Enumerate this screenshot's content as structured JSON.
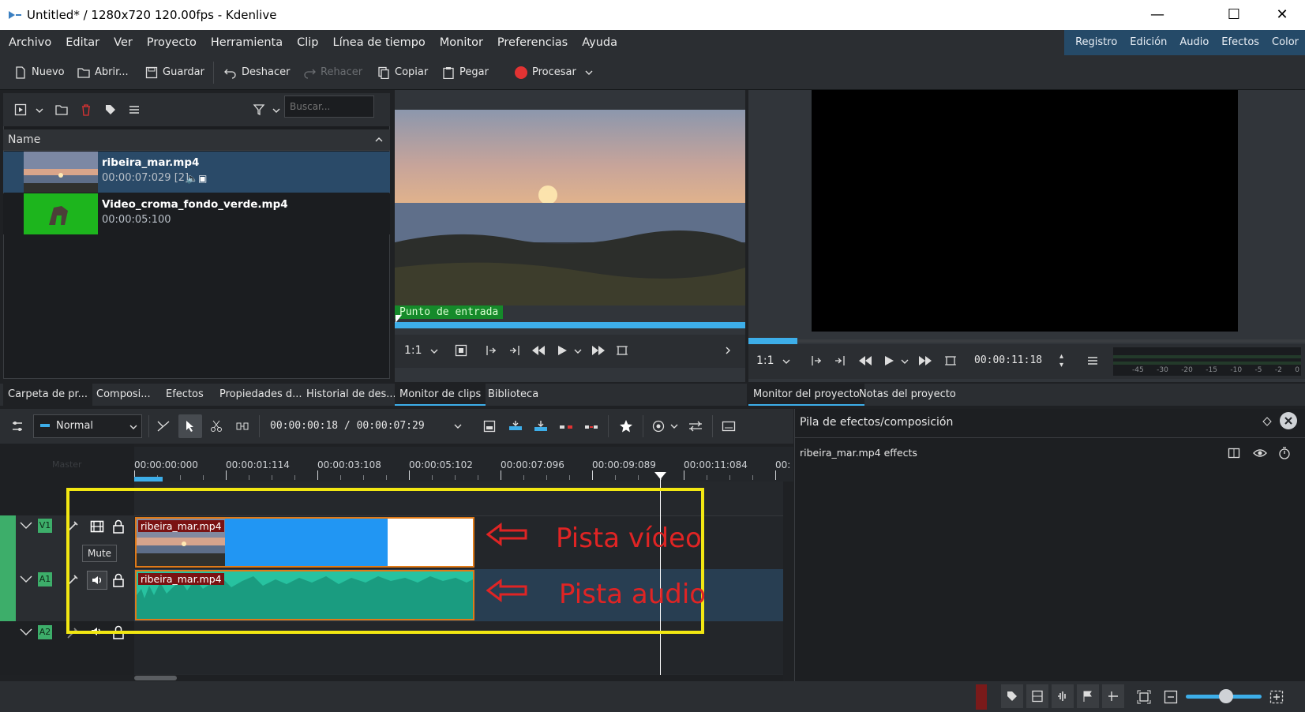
{
  "window": {
    "title": "Untitled* / 1280x720 120.00fps - Kdenlive",
    "minimize": "—",
    "maximize": "☐",
    "close": "✕"
  },
  "menu": [
    "Archivo",
    "Editar",
    "Ver",
    "Proyecto",
    "Herramienta",
    "Clip",
    "Línea de tiempo",
    "Monitor",
    "Preferencias",
    "Ayuda"
  ],
  "workspaces": [
    "Registro",
    "Edición",
    "Audio",
    "Efectos",
    "Color"
  ],
  "toolbar": {
    "new": "Nuevo",
    "open": "Abrir...",
    "save": "Guardar",
    "undo": "Deshacer",
    "redo": "Rehacer",
    "copy": "Copiar",
    "paste": "Pegar",
    "render": "Procesar"
  },
  "bin": {
    "search_placeholder": "Buscar...",
    "column_name": "Name",
    "clips": [
      {
        "name": "ribeira_mar.mp4",
        "duration": "00:00:07:029 [2]"
      },
      {
        "name": "Video_croma_fondo_verde.mp4",
        "duration": "00:00:05:100"
      }
    ]
  },
  "clip_monitor": {
    "zoom": "1:1",
    "in_point_label": "Punto de entrada"
  },
  "project_monitor": {
    "zoom": "1:1",
    "timecode": "00:00:11:18",
    "meter_labels": [
      "-45",
      "-30",
      "-20",
      "-15",
      "-10",
      "-5",
      "-2",
      "0"
    ]
  },
  "left_tabs": [
    "Carpeta de pr...",
    "Composi...",
    "Efectos",
    "Propiedades d...",
    "Historial de des...",
    "Monitor de clips",
    "Biblioteca"
  ],
  "right_tabs": [
    "Monitor del proyecto",
    "Notas del proyecto"
  ],
  "timeline": {
    "mode": "Normal",
    "position": "00:00:00:18 / 00:00:07:29",
    "master_label": "Master",
    "ruler_ticks": [
      "00:00:00:000",
      "00:00:01:114",
      "00:00:03:108",
      "00:00:05:102",
      "00:00:07:096",
      "00:00:09:089",
      "00:00:11:084",
      "00:"
    ],
    "tracks": [
      {
        "id": "V1",
        "type": "video"
      },
      {
        "id": "A1",
        "type": "audio"
      },
      {
        "id": "A2",
        "type": "audio"
      }
    ],
    "clip_name_video": "ribeira_mar.mp4",
    "clip_name_audio": "ribeira_mar.mp4",
    "tooltip": "Mute"
  },
  "effects_panel": {
    "title": "Pila de efectos/composición",
    "item": "ribeira_mar.mp4 effects"
  },
  "annotations": {
    "video_label": "Pista vídeo",
    "audio_label": "Pista audio"
  },
  "colors": {
    "accent": "#3daee9",
    "workspace_bg": "#254a68",
    "video_clip": "#2196f3",
    "audio_wave": "#27c2a0",
    "annotation": "#e02424",
    "highlight_box": "#f2e712",
    "track_tag": "#3dae6a"
  }
}
